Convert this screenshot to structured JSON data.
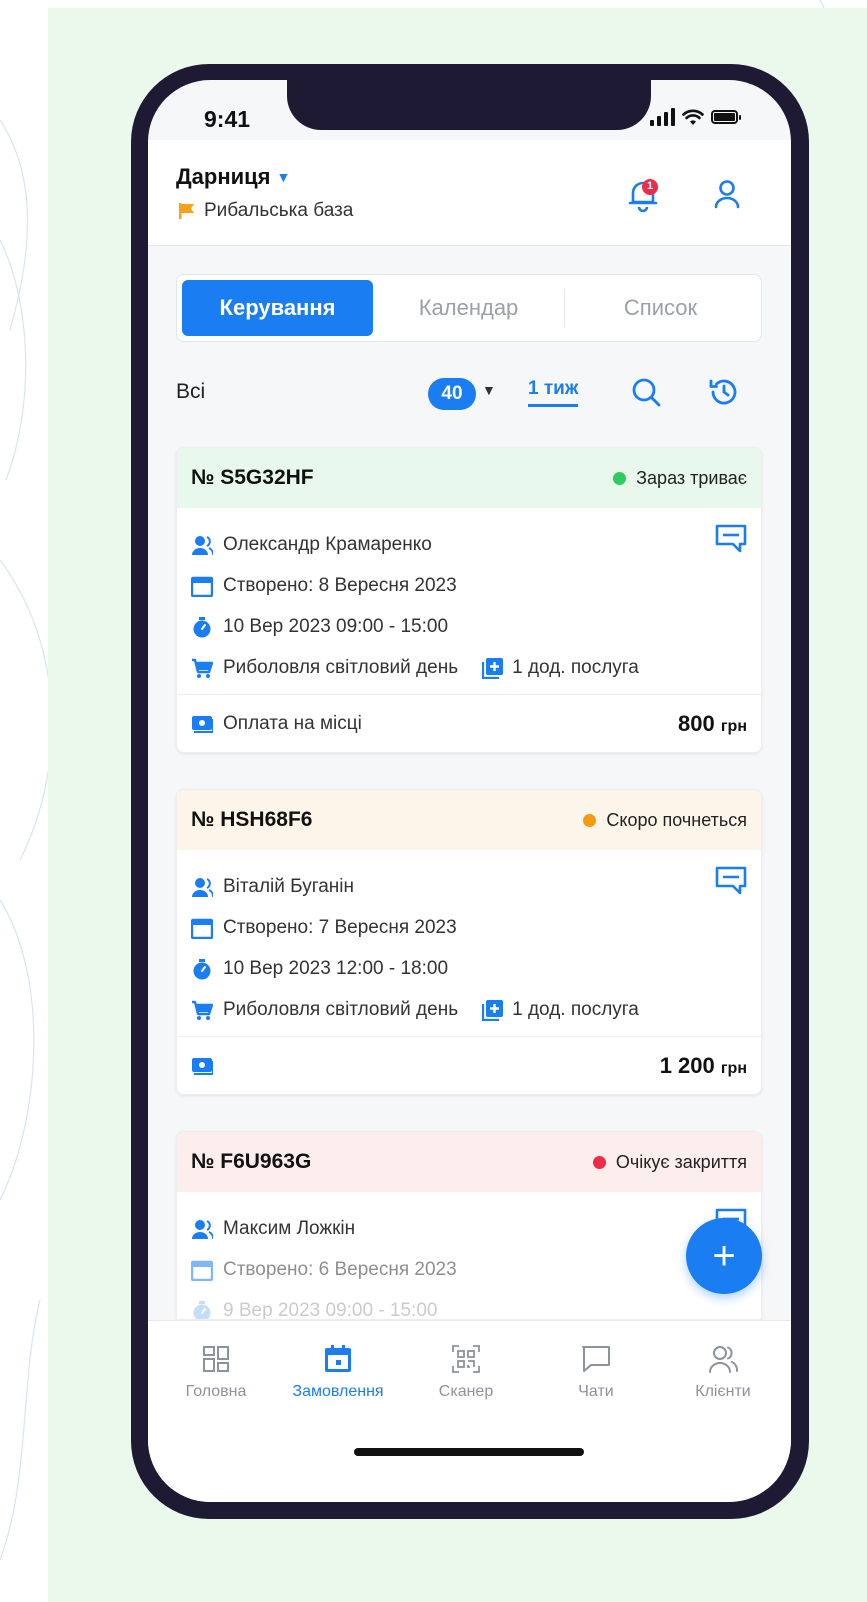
{
  "status_bar": {
    "time": "9:41"
  },
  "header": {
    "location": "Дарниця",
    "sublocation": "Рибальська база",
    "notifications_count": "1"
  },
  "tabs": [
    {
      "label": "Керування",
      "active": true
    },
    {
      "label": "Календар",
      "active": false
    },
    {
      "label": "Список",
      "active": false
    }
  ],
  "filters": {
    "scope": "Всі",
    "count": "40",
    "period": "1 тиж"
  },
  "orders": [
    {
      "number": "№ S5G32HF",
      "status": "Зараз триває",
      "status_color": "#2ecc5e",
      "head_bg": "#e9f8ec",
      "client": "Олександр Крамаренко",
      "created": "Створено: 8 Вересня 2023",
      "time": "10 Вер 2023 09:00 - 15:00",
      "service": "Риболовля світловий день",
      "extra": "1 дод. послуга",
      "payment": "Оплата на місці",
      "price": "800",
      "currency": "грн"
    },
    {
      "number": "№ HSH68F6",
      "status": "Скоро почнеться",
      "status_color": "#f39c12",
      "head_bg": "#fdf5ea",
      "client": "Віталій Буганін",
      "created": "Створено: 7 Вересня 2023",
      "time": "10 Вер 2023 12:00 - 18:00",
      "service": "Риболовля світловий день",
      "extra": "1 дод. послуга",
      "payment": "",
      "price": "1 200",
      "currency": "грн"
    },
    {
      "number": "№ F6U963G",
      "status": "Очікує закриття",
      "status_color": "#ee2c4a",
      "head_bg": "#fdeeee",
      "client": "Максим Ложкін",
      "created": "Створено: 6 Вересня 2023",
      "time": "9 Вер 2023 09:00 - 15:00"
    }
  ],
  "fab": {
    "label": "+"
  },
  "nav": [
    {
      "label": "Головна",
      "icon": "grid-icon",
      "active": false
    },
    {
      "label": "Замовлення",
      "icon": "calendar-icon",
      "active": true
    },
    {
      "label": "Сканер",
      "icon": "qr-icon",
      "active": false
    },
    {
      "label": "Чати",
      "icon": "chat-icon",
      "active": false
    },
    {
      "label": "Клієнти",
      "icon": "users-icon",
      "active": false
    }
  ],
  "colors": {
    "accent": "#1a7df2",
    "panel_bg": "#ebf8ec",
    "phone_frame": "#1f1a33",
    "flag": "#f7a21b"
  }
}
